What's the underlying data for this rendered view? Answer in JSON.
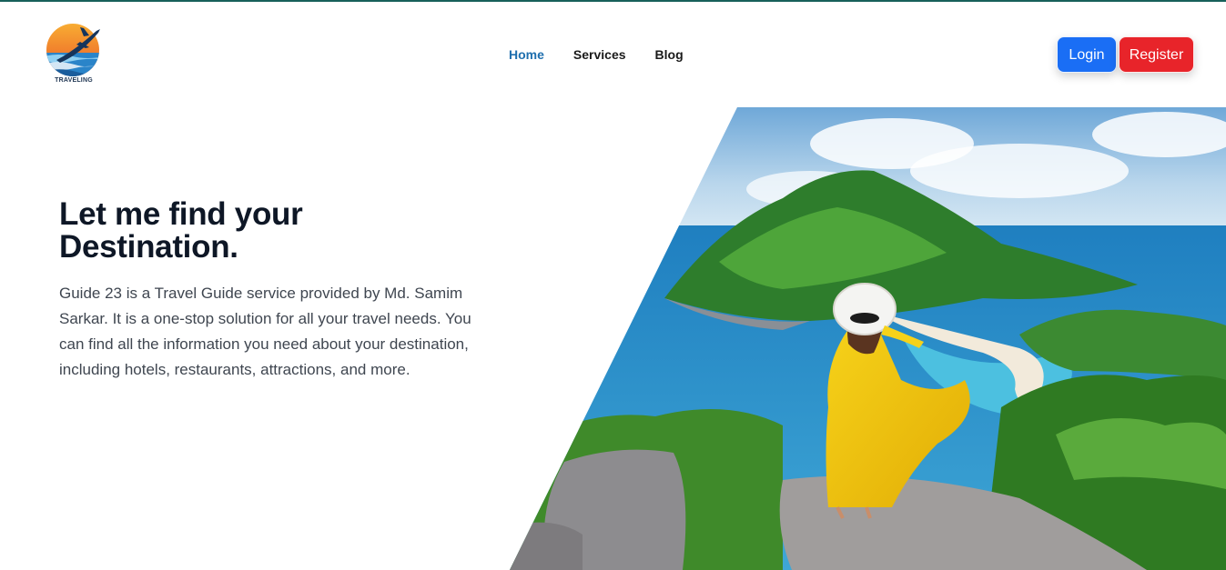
{
  "brand": {
    "logo_text": "TRAVELING"
  },
  "nav": {
    "items": [
      {
        "label": "Home",
        "active": true
      },
      {
        "label": "Services",
        "active": false
      },
      {
        "label": "Blog",
        "active": false
      }
    ]
  },
  "auth": {
    "login_label": "Login",
    "register_label": "Register"
  },
  "hero": {
    "title": "Let me find your Destination.",
    "description": "Guide 23 is a Travel Guide service provided by Md. Samim Sarkar. It is a one-stop solution for all your travel needs. You can find all the information you need about your destination, including hotels, restaurants, attractions, and more."
  },
  "colors": {
    "accent_nav": "#1f6fae",
    "login": "#1a6ef5",
    "register": "#e8242a",
    "top_border": "#17605a"
  }
}
